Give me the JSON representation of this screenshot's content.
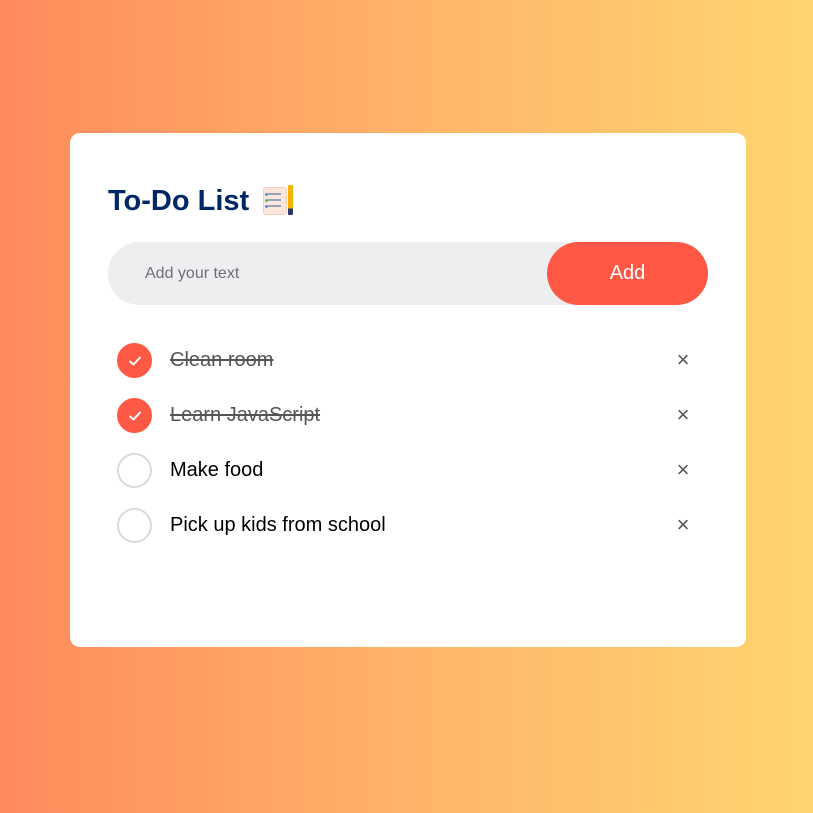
{
  "app": {
    "title": "To-Do List",
    "title_icon": "notepad-icon"
  },
  "input": {
    "placeholder": "Add your text",
    "value": ""
  },
  "add_button": {
    "label": "Add"
  },
  "colors": {
    "accent": "#ff5945",
    "title": "#002765",
    "input_bg": "#edeef0",
    "gradient_start": "#ff8a5c",
    "gradient_end": "#ffd56f"
  },
  "todos": [
    {
      "text": "Clean room",
      "done": true,
      "icon": "check-icon"
    },
    {
      "text": "Learn JavaScript",
      "done": true,
      "icon": "check-icon"
    },
    {
      "text": "Make food",
      "done": false
    },
    {
      "text": "Pick up kids from school",
      "done": false
    }
  ],
  "delete_symbol": "×"
}
